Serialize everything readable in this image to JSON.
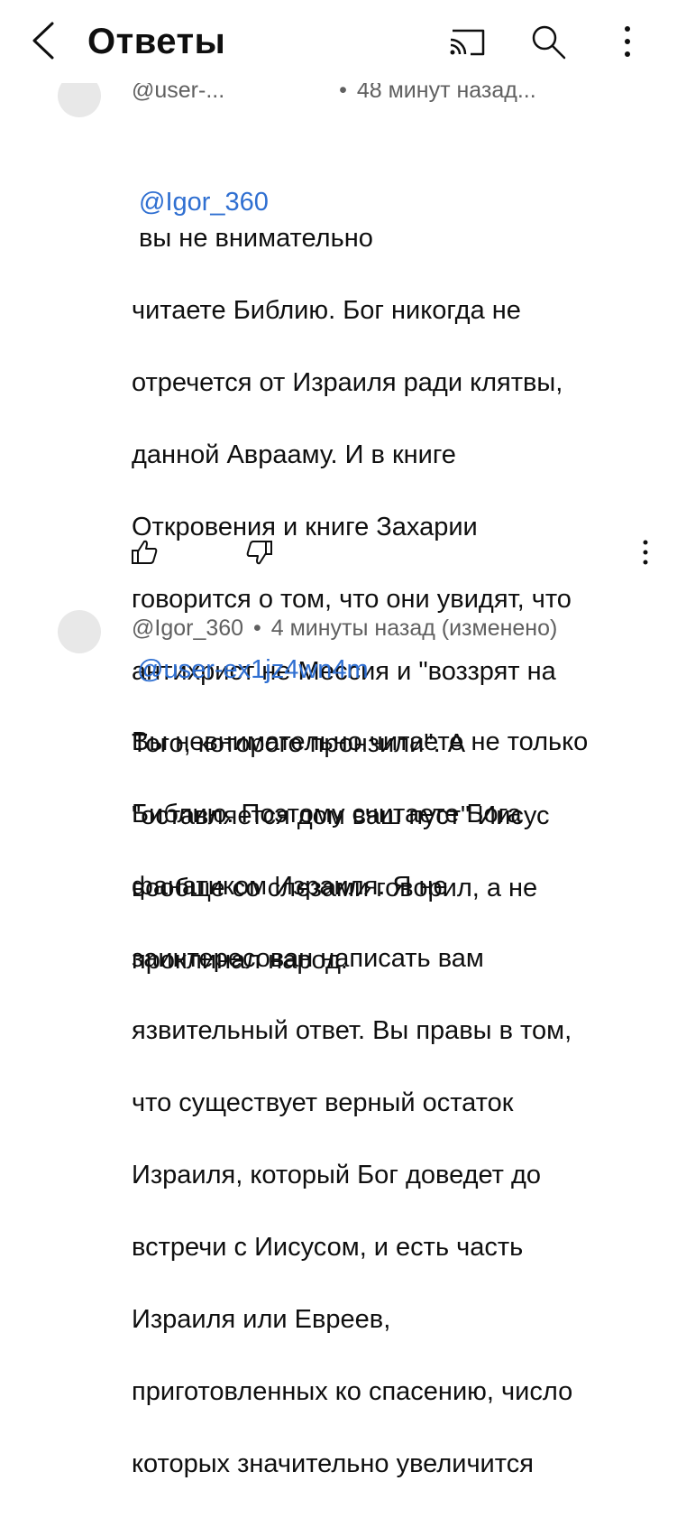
{
  "header": {
    "title": "Ответы",
    "icons": [
      "back-arrow-icon",
      "cast-icon",
      "search-icon",
      "more-vert-icon"
    ]
  },
  "comments": [
    {
      "author": "@user-...",
      "time": "48 минут назад...",
      "mention": "@Igor_360",
      "lines": [
        "вы не внимательно",
        "читаете Библию. Бог никогда не",
        "отречется от Израиля ради клятвы,",
        "данной Аврааму. И в книге",
        "Откровения и книге Захарии",
        "говорится о том, что они увидят, что",
        "антихрист не Мессия и \"воззрят на",
        "Того, которого пронзили\". А",
        "\"оставляется дом ваш пуст\" Иисус",
        "вообще со слезами говорил, а не",
        "проклинал народ."
      ],
      "actions": [
        "like-icon",
        "dislike-icon",
        "more-vert-icon"
      ]
    },
    {
      "author": "@Igor_360",
      "time": "4 минуты назад (изменено)",
      "mention": "@user-ex1jz4wn4m",
      "lines": [
        "Вы невнимательно читаете не только",
        "Библию. Поэтому считаете Бога",
        "фанатиком Израиля. Я не",
        "заинтересован написать вам",
        "язвительный ответ. Вы правы в том,",
        "что существует верный остаток",
        "Израиля, который Бог доведет до",
        "встречи с Иисусом, и есть часть",
        "Израиля или Евреев,",
        "приготовленных ко спасению, число",
        "которых значительно увеличится"
      ]
    }
  ],
  "colors": {
    "mention": "#2f6fd1",
    "meta": "#606060",
    "avatar": "#e8e8e8"
  }
}
